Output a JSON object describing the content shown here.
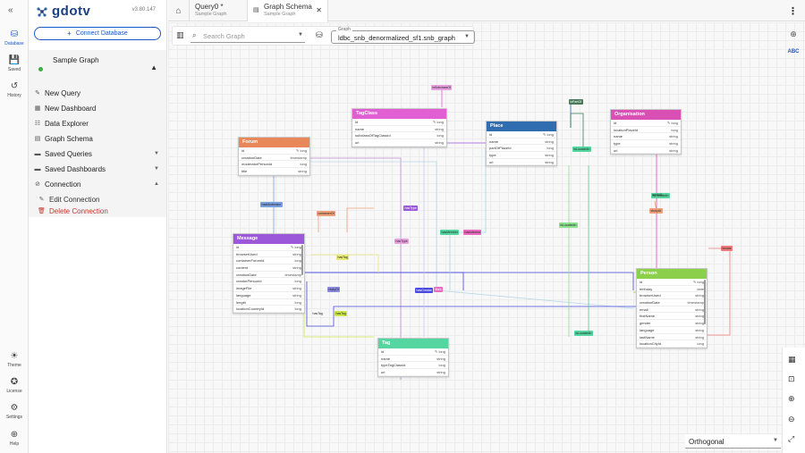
{
  "rail": {
    "items": [
      {
        "icon": "database-icon",
        "label": "Database"
      },
      {
        "icon": "saved-icon",
        "label": "Saved"
      },
      {
        "icon": "history-icon",
        "label": "History"
      },
      {
        "icon": "theme-icon",
        "label": "Theme"
      },
      {
        "icon": "license-icon",
        "label": "License"
      },
      {
        "icon": "settings-icon",
        "label": "Settings"
      },
      {
        "icon": "help-icon",
        "label": "Help"
      }
    ]
  },
  "sidebar": {
    "brand": "gdotv",
    "version": "v3.80.147",
    "connect_label": "Connect Database",
    "database_name": "Sample Graph",
    "menu": [
      {
        "label": "New Query"
      },
      {
        "label": "New Dashboard"
      },
      {
        "label": "Data Explorer"
      },
      {
        "label": "Graph Schema"
      },
      {
        "label": "Saved Queries"
      },
      {
        "label": "Saved Dashboards"
      },
      {
        "label": "Connection"
      }
    ],
    "connection_sub": [
      "Edit Connection",
      "Delete Connection"
    ]
  },
  "tabs": [
    {
      "title": "Query0 *",
      "subtitle": "Sample Graph"
    },
    {
      "title": "Graph Schema",
      "subtitle": "Sample Graph"
    }
  ],
  "toolbar": {
    "search_placeholder": "Search Graph",
    "graph_label": "Graph",
    "graph_value": "ldbc_snb_denormalized_sf1.snb_graph",
    "layout_value": "Orthogonal"
  },
  "colors": {
    "tagclass": "#e05fd3",
    "place": "#2f6cb0",
    "organisation": "#d94fb3",
    "forum": "#e8875a",
    "message": "#9b59d9",
    "person": "#8ccf4a",
    "tag": "#55d6a1",
    "accent": "#1a56c4"
  },
  "nodes": {
    "tagclass": {
      "title": "TagClass",
      "rows": [
        [
          "id",
          "long"
        ],
        [
          "name",
          "string"
        ],
        [
          "subclassOfTagClassId",
          "long"
        ],
        [
          "url",
          "string"
        ]
      ]
    },
    "place": {
      "title": "Place",
      "rows": [
        [
          "id",
          "long"
        ],
        [
          "name",
          "string"
        ],
        [
          "partOfPlaceId",
          "long"
        ],
        [
          "type",
          "string"
        ],
        [
          "url",
          "string"
        ]
      ]
    },
    "organisation": {
      "title": "Organisation",
      "rows": [
        [
          "id",
          "long"
        ],
        [
          "locationPlaceId",
          "long"
        ],
        [
          "name",
          "string"
        ],
        [
          "type",
          "string"
        ],
        [
          "url",
          "string"
        ]
      ]
    },
    "forum": {
      "title": "Forum",
      "rows": [
        [
          "id",
          "long"
        ],
        [
          "creationDate",
          "timestamp"
        ],
        [
          "moderatorPersonId",
          "long"
        ],
        [
          "title",
          "string"
        ]
      ]
    },
    "message": {
      "title": "Message",
      "rows": [
        [
          "id",
          "long"
        ],
        [
          "browserUsed",
          "string"
        ],
        [
          "containerForumId",
          "long"
        ],
        [
          "content",
          "string"
        ],
        [
          "creationDate",
          "timestamp"
        ],
        [
          "creatorPersonId",
          "long"
        ],
        [
          "imageFile",
          "string"
        ],
        [
          "language",
          "string"
        ],
        [
          "length",
          "long"
        ],
        [
          "locationCountryId",
          "long"
        ]
      ]
    },
    "person": {
      "title": "Person",
      "rows": [
        [
          "id",
          "long"
        ],
        [
          "birthday",
          "date"
        ],
        [
          "browserUsed",
          "string"
        ],
        [
          "creationDate",
          "timestamp"
        ],
        [
          "email",
          "string"
        ],
        [
          "firstName",
          "string"
        ],
        [
          "gender",
          "string"
        ],
        [
          "language",
          "string"
        ],
        [
          "lastName",
          "string"
        ],
        [
          "locationCityId",
          "long"
        ]
      ]
    },
    "tag": {
      "title": "Tag",
      "rows": [
        [
          "id",
          "long"
        ],
        [
          "name",
          "string"
        ],
        [
          "typeTagClassId",
          "long"
        ],
        [
          "url",
          "string"
        ]
      ]
    }
  },
  "edge_labels": [
    "isSubclassOf",
    "isPartOf",
    "isLocatedIn",
    "isLocatedIn",
    "containerOf",
    "hasModerator",
    "hasCreator",
    "replyOf",
    "hasTag",
    "hasType",
    "hasMember",
    "hasInterest",
    "hasTag",
    "isLocatedIn",
    "likes",
    "workAt",
    "studyAt",
    "knows",
    "hasType",
    "isLocatedIn",
    "hasTag"
  ]
}
